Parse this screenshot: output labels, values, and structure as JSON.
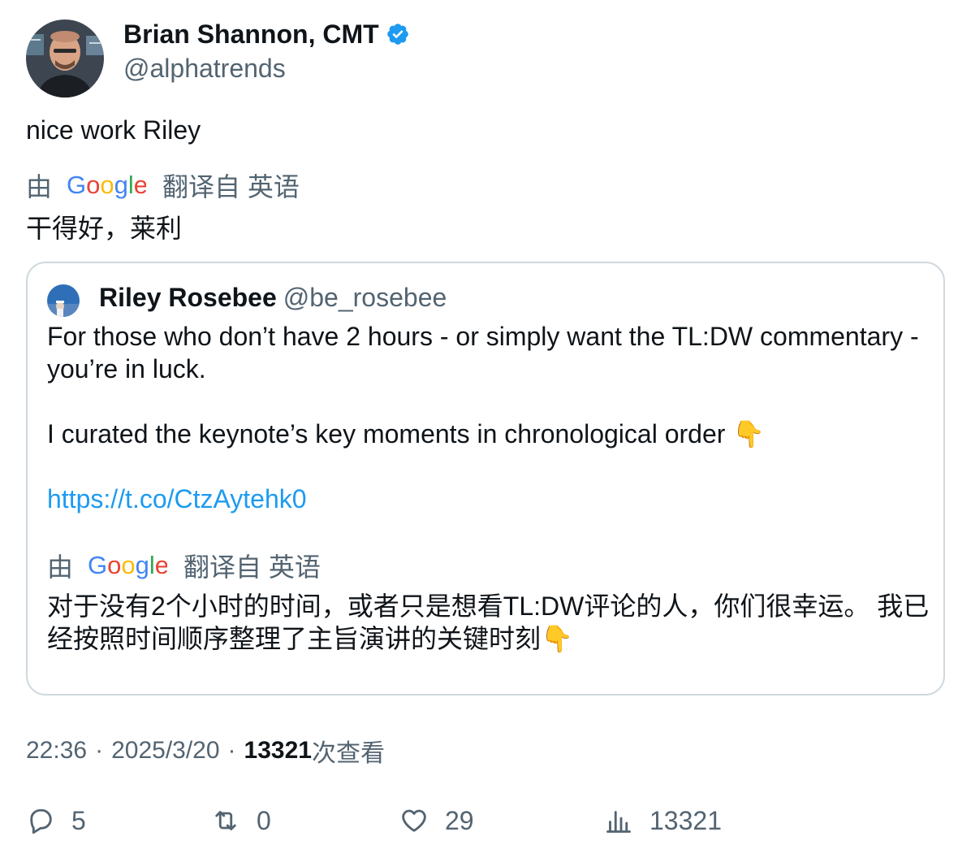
{
  "author": {
    "name": "Brian Shannon, CMT",
    "handle": "@alphatrends",
    "verified": true
  },
  "tweet": {
    "text": "nice work Riley",
    "translation": {
      "by": "由",
      "provider": "Google",
      "from_language": "翻译自 英语",
      "text": "干得好，莱利"
    }
  },
  "quote": {
    "name": "Riley Rosebee",
    "handle": "@be_rosebee",
    "lines": [
      "For those who don’t have 2 hours - or simply want the TL:DW commentary - you’re in luck.",
      "I curated the keynote’s key moments in chronological order",
      "https://t.co/CtzAytehk0"
    ],
    "emoji": "👇",
    "translation": {
      "by": "由",
      "provider": "Google",
      "from_language": "翻译自 英语",
      "text": "对于没有2个小时的时间，或者只是想看TL:DW评论的人，你们很幸运。 我已经按照时间顺序整理了主旨演讲的关键时刻👇"
    }
  },
  "meta": {
    "time": "22:36",
    "date": "2025/3/20",
    "separator": "·",
    "views_count": "13321",
    "views_label": "次查看"
  },
  "actions": {
    "replies": "5",
    "reposts": "0",
    "likes": "29",
    "views": "13321"
  },
  "colors": {
    "link": "#1d9bf0",
    "secondary": "#536471",
    "primary": "#0f1419",
    "border": "#cfd9de",
    "verified": "#1d9bf0"
  }
}
